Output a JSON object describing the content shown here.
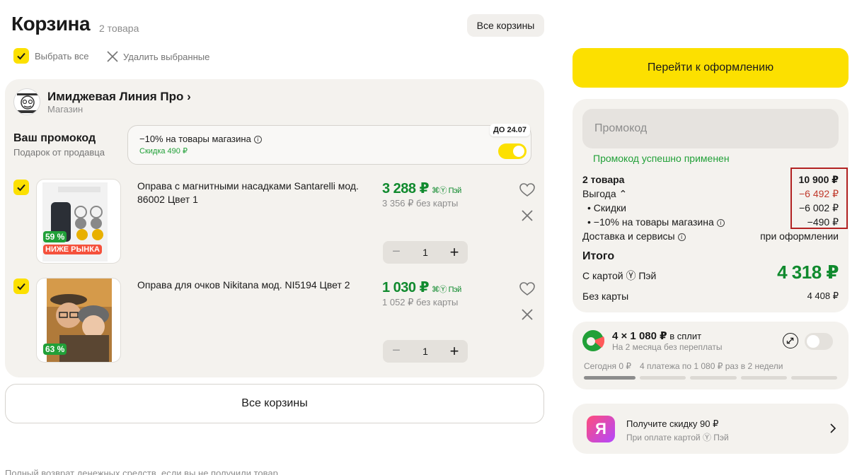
{
  "header": {
    "title": "Корзина",
    "count": "2 товара",
    "all_carts": "Все корзины"
  },
  "toolbar": {
    "select_all": "Выбрать все",
    "delete_selected": "Удалить выбранные"
  },
  "store": {
    "name": "Имиджевая Линия Про ›",
    "subtitle": "Магазин",
    "promo_title": "Ваш промокод",
    "promo_subtitle": "Подарок от продавца",
    "promo_desc": "−10% на товары магазина",
    "promo_discount": "Скидка 490 ₽",
    "promo_badge": "ДО 24.07"
  },
  "items": [
    {
      "title": "Оправа с магнитными насадками Santarelli мод. 86002 Цвет 1",
      "price": "3 288 ₽",
      "pay_tag": "Пэй",
      "old_price": "3 356 ₽ без карты",
      "discount_badge": "59 %",
      "extra_badge": "НИЖЕ РЫНКА",
      "quantity": "1"
    },
    {
      "title": "Оправа для очков Nikitana мод. NI5194 Цвет 2",
      "price": "1 030 ₽",
      "pay_tag": "Пэй",
      "old_price": "1 052 ₽ без карты",
      "discount_badge": "63 %",
      "quantity": "1"
    }
  ],
  "all_carts_bottom": "Все корзины",
  "footer_note": "Полный возврат денежных средств, если вы не получили товар",
  "summary": {
    "checkout": "Перейти к оформлению",
    "promo_placeholder": "Промокод",
    "promo_applied": "Промокод успешно применен",
    "rows": [
      {
        "label": "2 товара",
        "value": "10 900 ₽"
      },
      {
        "label": "Выгода ⌃",
        "value": "−6 492 ₽"
      },
      {
        "label": "• Скидки",
        "value": "−6 002 ₽"
      },
      {
        "label": "• −10% на товары магазина",
        "value": "−490 ₽"
      },
      {
        "label": "Доставка и сервисы",
        "value": "при оформлении"
      }
    ],
    "total_title": "Итого",
    "total_card_label": "С картой Ⓨ Пэй",
    "total_value": "4 318 ₽",
    "nocard_label": "Без карты",
    "nocard_value": "4 408 ₽"
  },
  "split": {
    "amount": "4 × 1 080 ₽",
    "suffix": " в сплит",
    "subtitle": "На 2 месяца без переплаты",
    "today": "Сегодня 0 ₽",
    "schedule": "4 платежа по 1 080 ₽ раз в 2 недели"
  },
  "ya_promo": {
    "logo": "Я",
    "title": "Получите скидку 90 ₽",
    "subtitle": "При оплате картой Ⓨ Пэй"
  },
  "colors": {
    "accent": "#fce000",
    "price_green": "#108a2e",
    "success_green": "#21a038",
    "discount_red": "#c0392b"
  }
}
